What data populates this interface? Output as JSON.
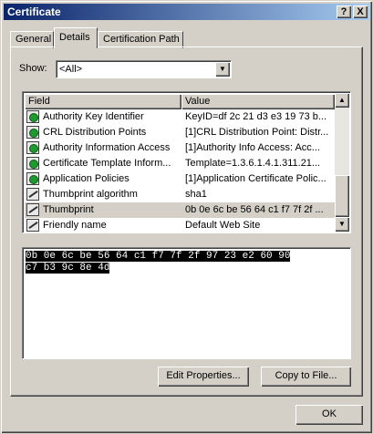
{
  "window": {
    "title": "Certificate",
    "help_label": "?",
    "close_label": "X"
  },
  "tabs": [
    {
      "label": "General",
      "active": false
    },
    {
      "label": "Details",
      "active": true
    },
    {
      "label": "Certification Path",
      "active": false
    }
  ],
  "show": {
    "label": "Show:",
    "value": "<All>"
  },
  "list": {
    "columns": [
      "Field",
      "Value"
    ],
    "rows": [
      {
        "field": "Authority Key Identifier",
        "value": "KeyID=df 2c 21 d3 e3 19 73 b...",
        "icon": "cert-extension-icon",
        "selected": false
      },
      {
        "field": "CRL Distribution Points",
        "value": "[1]CRL Distribution Point: Distr...",
        "icon": "cert-extension-icon",
        "selected": false
      },
      {
        "field": "Authority Information Access",
        "value": "[1]Authority Info Access: Acc...",
        "icon": "cert-extension-icon",
        "selected": false
      },
      {
        "field": "Certificate Template Inform...",
        "value": "Template=1.3.6.1.4.1.311.21...",
        "icon": "cert-extension-icon",
        "selected": false
      },
      {
        "field": "Application Policies",
        "value": "[1]Application Certificate Polic...",
        "icon": "cert-extension-icon",
        "selected": false
      },
      {
        "field": "Thumbprint algorithm",
        "value": "sha1",
        "icon": "cert-property-icon",
        "selected": false
      },
      {
        "field": "Thumbprint",
        "value": "0b 0e 6c be 56 64 c1 f7 7f 2f ...",
        "icon": "cert-property-icon",
        "selected": true
      },
      {
        "field": "Friendly name",
        "value": "Default Web Site",
        "icon": "cert-property-icon",
        "selected": false
      }
    ]
  },
  "detail": {
    "line1": "0b 0e 6c be 56 64 c1 f7 7f 2f 97 23 e2 60 90",
    "line2": "c7 b3 9c 8e 4d"
  },
  "buttons": {
    "edit_properties": "Edit Properties...",
    "copy_to_file": "Copy to File...",
    "ok": "OK"
  }
}
